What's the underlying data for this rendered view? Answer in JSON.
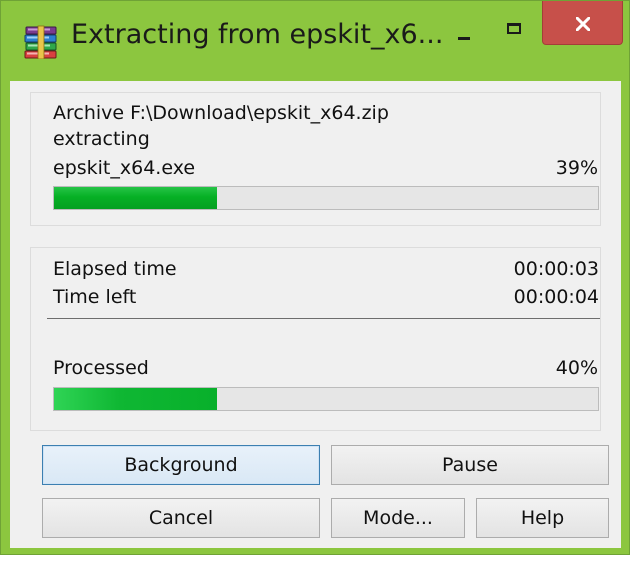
{
  "window": {
    "title": "Extracting from epskit_x6...",
    "accent_color": "#8cc63f",
    "close_color": "#c7504a",
    "icons": {
      "app": "winrar-books-icon",
      "minimize": "minimize-icon",
      "maximize": "maximize-icon",
      "close": "close-icon"
    }
  },
  "archive": {
    "path_label": "Archive F:\\Download\\epskit_x64.zip",
    "action": "extracting",
    "file_name": "epskit_x64.exe",
    "file_percent_text": "39%",
    "file_progress": 0.3
  },
  "stats": {
    "elapsed_label": "Elapsed time",
    "elapsed_value": "00:00:03",
    "left_label": "Time left",
    "left_value": "00:00:04",
    "processed_label": "Processed",
    "processed_percent_text": "40%",
    "processed_progress": 0.3
  },
  "buttons": {
    "background": "Background",
    "pause": "Pause",
    "cancel": "Cancel",
    "mode": "Mode...",
    "help": "Help"
  }
}
